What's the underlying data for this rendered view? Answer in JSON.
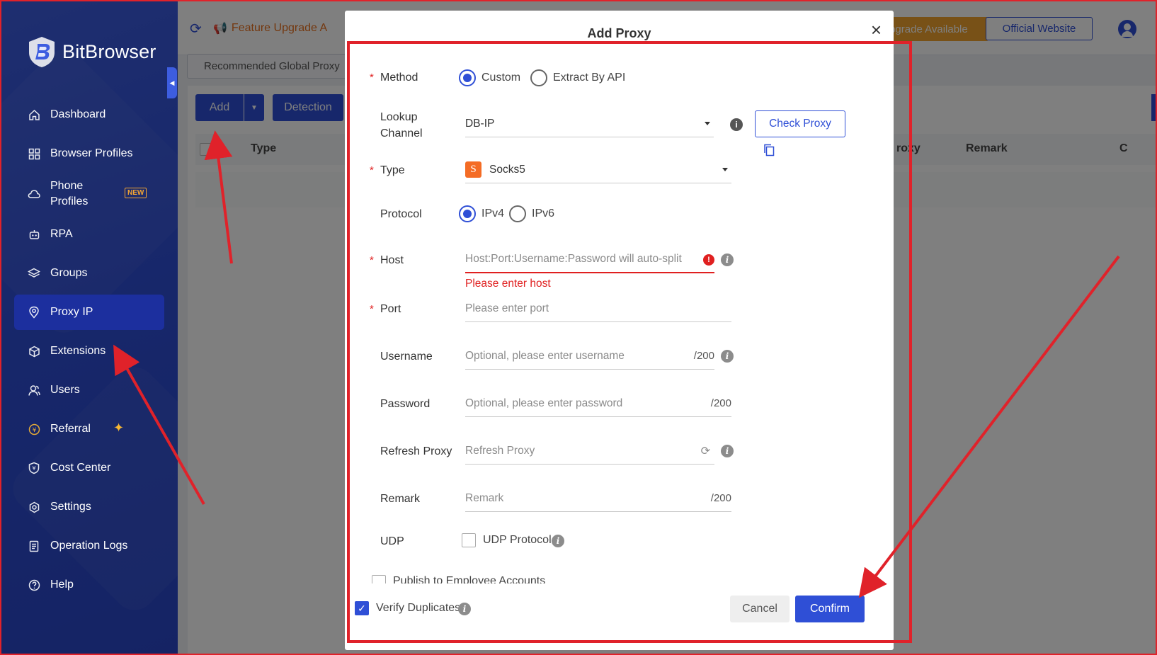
{
  "app": {
    "name": "BitBrowser",
    "feature_upgrade": "Feature Upgrade A",
    "upgrade_available": "Upgrade Available",
    "official_website": "Official Website"
  },
  "sidebar": {
    "items": [
      {
        "label": "Dashboard",
        "icon": "home-icon"
      },
      {
        "label": "Browser Profiles",
        "icon": "grid-icon"
      },
      {
        "label": "Phone Profiles",
        "icon": "cloud-phone-icon",
        "badge": "NEW"
      },
      {
        "label": "RPA",
        "icon": "robot-icon"
      },
      {
        "label": "Groups",
        "icon": "layers-icon"
      },
      {
        "label": "Proxy IP",
        "icon": "location-pin-icon",
        "active": true
      },
      {
        "label": "Extensions",
        "icon": "cube-icon"
      },
      {
        "label": "Users",
        "icon": "users-icon"
      },
      {
        "label": "Referral",
        "icon": "coin-icon"
      },
      {
        "label": "Cost Center",
        "icon": "shield-yen-icon"
      },
      {
        "label": "Settings",
        "icon": "gear-icon"
      },
      {
        "label": "Operation Logs",
        "icon": "log-icon"
      },
      {
        "label": "Help",
        "icon": "help-icon"
      }
    ]
  },
  "content": {
    "tab": "Recommended Global Proxy",
    "add_label": "Add",
    "detection_label": "Detection",
    "columns": {
      "type": "Type",
      "proxy": "roxy",
      "remark": "Remark",
      "c": "C"
    }
  },
  "modal": {
    "title": "Add Proxy",
    "method": {
      "label": "Method",
      "options": [
        "Custom",
        "Extract By API"
      ],
      "selected": "Custom"
    },
    "lookup": {
      "label_line1": "Lookup",
      "label_line2": "Channel",
      "value": "DB-IP",
      "check_label": "Check Proxy"
    },
    "type": {
      "label": "Type",
      "badge": "S",
      "value": "Socks5"
    },
    "protocol": {
      "label": "Protocol",
      "options": [
        "IPv4",
        "IPv6"
      ],
      "selected": "IPv4"
    },
    "host": {
      "label": "Host",
      "placeholder": "Host:Port:Username:Password will auto-split",
      "error": "Please enter host"
    },
    "port": {
      "label": "Port",
      "placeholder": "Please enter port"
    },
    "username": {
      "label": "Username",
      "placeholder": "Optional, please enter username",
      "counter": "/200"
    },
    "password": {
      "label": "Password",
      "placeholder": "Optional, please enter password",
      "counter": "/200"
    },
    "refresh": {
      "label": "Refresh Proxy",
      "placeholder": "Refresh Proxy"
    },
    "remark": {
      "label": "Remark",
      "placeholder": "Remark",
      "counter": "/200"
    },
    "udp": {
      "label": "UDP",
      "checkbox_label": "UDP Protocol",
      "checked": false
    },
    "publish": {
      "label": "Publish to Employee Accounts"
    },
    "verify": {
      "label": "Verify Duplicates",
      "checked": true
    },
    "cancel_label": "Cancel",
    "confirm_label": "Confirm"
  },
  "colors": {
    "primary": "#2f4fd6",
    "sidebar": "#3d5de0",
    "error": "#e02020",
    "annotation": "#e0222a",
    "warning": "#f0a22e"
  }
}
